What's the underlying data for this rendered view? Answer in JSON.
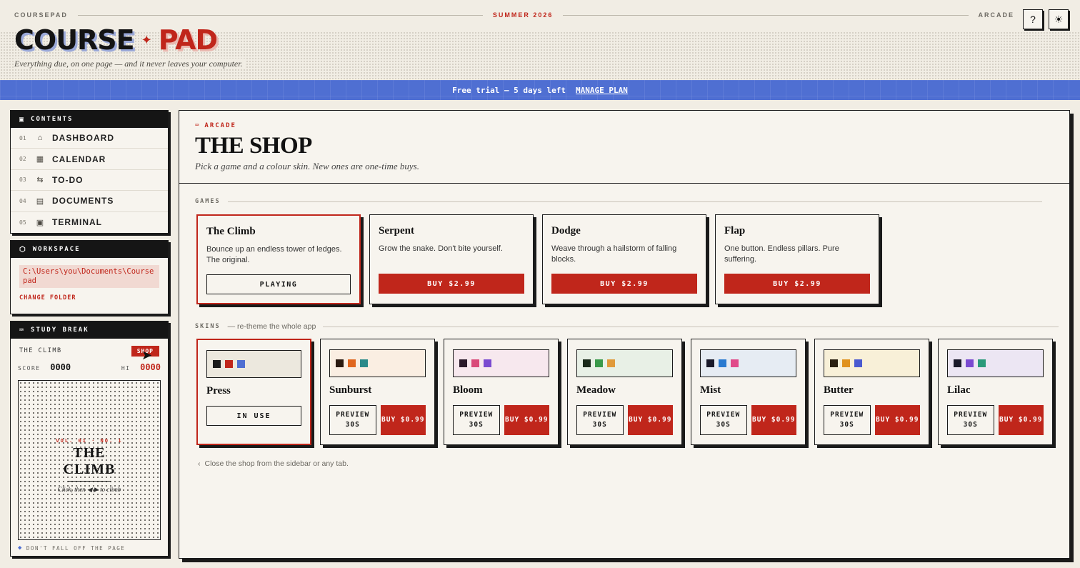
{
  "header": {
    "brand_small": "COURSEPAD",
    "season": "SUMMER 2026",
    "section_small": "ARCADE",
    "logo_word1": "COURSE",
    "logo_star": "✦",
    "logo_word2": "PAD",
    "tagline": "Everything due, on one page — and it never leaves your computer."
  },
  "banner": {
    "text": "Free trial — 5 days left",
    "link": "MANAGE PLAN"
  },
  "sidebar": {
    "contents_title": "CONTENTS",
    "nav": [
      {
        "num": "01",
        "label": "DASHBOARD"
      },
      {
        "num": "02",
        "label": "CALENDAR"
      },
      {
        "num": "03",
        "label": "TO-DO"
      },
      {
        "num": "04",
        "label": "DOCUMENTS"
      },
      {
        "num": "05",
        "label": "TERMINAL"
      }
    ],
    "workspace_title": "WORKSPACE",
    "workspace_path": "C:\\Users\\you\\Documents\\Coursepad",
    "change_folder": "CHANGE FOLDER",
    "study_title": "STUDY BREAK",
    "game_name": "THE CLIMB",
    "shop_label": "SHOP",
    "score_label": "SCORE",
    "score_value": "0000",
    "hi_label": "HI",
    "hi_value": "0000",
    "screen_vol": "VOL. 01 · NO. 1",
    "screen_title": "THE CLIMB",
    "screen_hint": "Click, then ◀ ▶ to climb",
    "footer": "DON'T FALL OFF THE PAGE"
  },
  "main": {
    "eyebrow": "ARCADE",
    "title": "THE SHOP",
    "subtitle": "Pick a game and a colour skin. New ones are one-time buys.",
    "games_label": "GAMES",
    "games": [
      {
        "name": "The Climb",
        "desc": "Bounce up an endless tower of ledges. The original.",
        "action": "PLAYING"
      },
      {
        "name": "Serpent",
        "desc": "Grow the snake. Don't bite yourself.",
        "action": "BUY $2.99"
      },
      {
        "name": "Dodge",
        "desc": "Weave through a hailstorm of falling blocks.",
        "action": "BUY $2.99"
      },
      {
        "name": "Flap",
        "desc": "One button. Endless pillars. Pure suffering.",
        "action": "BUY $2.99"
      }
    ],
    "skins_label": "SKINS",
    "skins_aside": "— re-theme the whole app",
    "skins": [
      {
        "name": "Press",
        "colors": [
          "#1a1a1a",
          "#c0261b",
          "#4f6fd2"
        ],
        "bg": "#ece8de",
        "in_use": "IN USE"
      },
      {
        "name": "Sunburst",
        "colors": [
          "#2a1a10",
          "#e0661e",
          "#2a8a8a"
        ],
        "bg": "#faeee2",
        "preview": "PREVIEW 30S",
        "buy": "BUY $0.99"
      },
      {
        "name": "Bloom",
        "colors": [
          "#2a1a2a",
          "#d94a7a",
          "#7a4ad0"
        ],
        "bg": "#f7e8ee",
        "preview": "PREVIEW 30S",
        "buy": "BUY $0.99"
      },
      {
        "name": "Meadow",
        "colors": [
          "#1a2a1a",
          "#3a9a4a",
          "#e09a3a"
        ],
        "bg": "#e8f0e6",
        "preview": "PREVIEW 30S",
        "buy": "BUY $0.99"
      },
      {
        "name": "Mist",
        "colors": [
          "#1a1a2a",
          "#2a7ad0",
          "#e04a8a"
        ],
        "bg": "#e6ecf3",
        "preview": "PREVIEW 30S",
        "buy": "BUY $0.99"
      },
      {
        "name": "Butter",
        "colors": [
          "#2a2010",
          "#e0921e",
          "#4a5ad0"
        ],
        "bg": "#f8f0d8",
        "preview": "PREVIEW 30S",
        "buy": "BUY $0.99"
      },
      {
        "name": "Lilac",
        "colors": [
          "#1a1a2a",
          "#7a4ad0",
          "#2a9a7a"
        ],
        "bg": "#ece6f3",
        "preview": "PREVIEW 30S",
        "buy": "BUY $0.99"
      }
    ],
    "close_note": "Close the shop from the sidebar or any tab."
  }
}
